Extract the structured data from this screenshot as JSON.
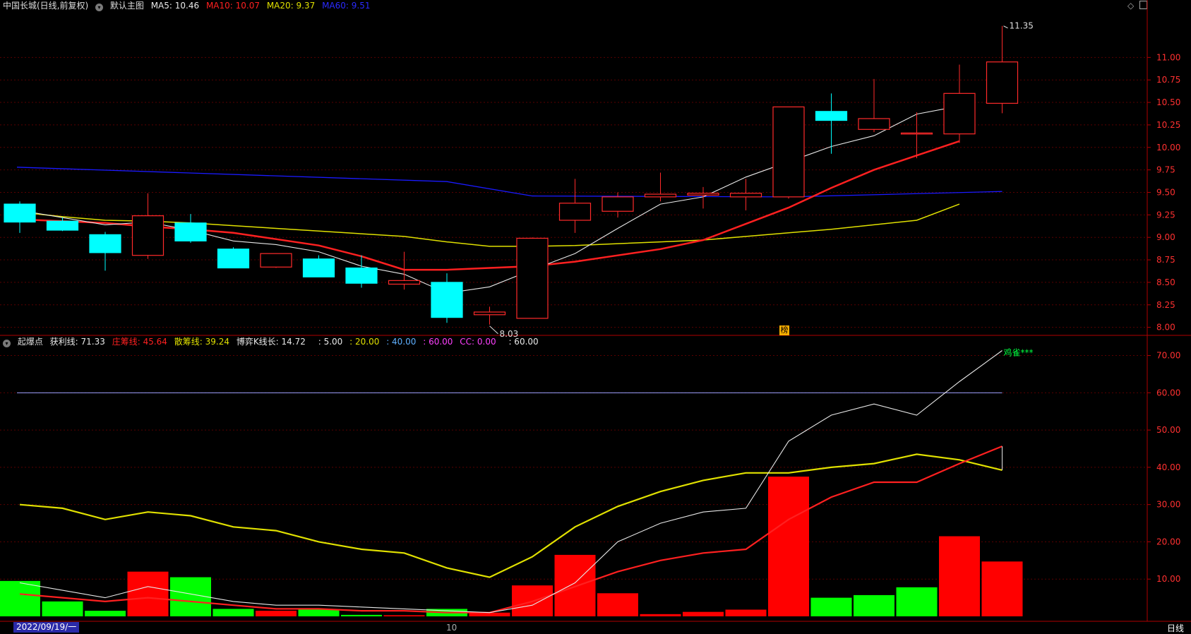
{
  "header_top": {
    "title": "中国长城(日线,前复权)",
    "main_chart": "默认主图",
    "ma5": "MA5: 10.46",
    "ma10": "MA10: 10.07",
    "ma20": "MA20: 9.37",
    "ma60": "MA60: 9.51"
  },
  "header_bottom": {
    "name": "起爆点",
    "profit": "获利线: 71.33",
    "dealer": "庄筹线: 45.64",
    "retail": "散筹线: 39.24",
    "game": "博弈K线长: 14.72",
    "v5": ": 5.00",
    "v20": ": 20.00",
    "v40": ": 40.00",
    "v60": ": 60.00",
    "cc": "CC: 0.00",
    "vw": ": 60.00"
  },
  "annotations": {
    "high_label": "11.35",
    "low_label": "8.03",
    "signal_label": "鸡雀***",
    "badge": "榜"
  },
  "footer": {
    "date": "2022/09/19/一",
    "month_label": "10",
    "period": "日线"
  },
  "colors": {
    "up": "#ff2a2a",
    "down": "#00ffff",
    "ma5": "#e8e8e8",
    "ma10": "#ff2020",
    "ma20": "#e0e000",
    "ma60": "#1a1aff",
    "bar_up": "#ff0000",
    "bar_down": "#00ff00",
    "grid": "#5a0000"
  },
  "chart_data": [
    {
      "type": "candlestick",
      "title": "中国长城(日线,前复权)",
      "ylim": [
        7.95,
        11.45
      ],
      "y_ticks": [
        8.0,
        8.25,
        8.5,
        8.75,
        9.0,
        9.25,
        9.5,
        9.75,
        10.0,
        10.25,
        10.5,
        10.75,
        11.0
      ],
      "candles": [
        {
          "o": 9.37,
          "h": 9.4,
          "l": 9.05,
          "c": 9.17
        },
        {
          "o": 9.18,
          "h": 9.22,
          "l": 9.07,
          "c": 9.08
        },
        {
          "o": 9.03,
          "h": 9.06,
          "l": 8.63,
          "c": 8.83
        },
        {
          "o": 8.8,
          "h": 9.49,
          "l": 8.76,
          "c": 9.24
        },
        {
          "o": 9.16,
          "h": 9.26,
          "l": 8.94,
          "c": 8.96
        },
        {
          "o": 8.87,
          "h": 8.89,
          "l": 8.66,
          "c": 8.66
        },
        {
          "o": 8.67,
          "h": 8.82,
          "l": 8.66,
          "c": 8.82
        },
        {
          "o": 8.76,
          "h": 8.8,
          "l": 8.56,
          "c": 8.56
        },
        {
          "o": 8.66,
          "h": 8.8,
          "l": 8.44,
          "c": 8.49
        },
        {
          "o": 8.48,
          "h": 8.84,
          "l": 8.42,
          "c": 8.52
        },
        {
          "o": 8.5,
          "h": 8.6,
          "l": 8.05,
          "c": 8.11
        },
        {
          "o": 8.14,
          "h": 8.23,
          "l": 8.03,
          "c": 8.17
        },
        {
          "o": 8.1,
          "h": 9.0,
          "l": 8.1,
          "c": 8.99
        },
        {
          "o": 9.19,
          "h": 9.65,
          "l": 9.05,
          "c": 9.38
        },
        {
          "o": 9.29,
          "h": 9.5,
          "l": 9.22,
          "c": 9.45
        },
        {
          "o": 9.45,
          "h": 9.72,
          "l": 9.4,
          "c": 9.48
        },
        {
          "o": 9.47,
          "h": 9.56,
          "l": 9.32,
          "c": 9.49
        },
        {
          "o": 9.45,
          "h": 9.65,
          "l": 9.3,
          "c": 9.49
        },
        {
          "o": 9.45,
          "h": 10.45,
          "l": 9.43,
          "c": 10.45
        },
        {
          "o": 10.4,
          "h": 10.6,
          "l": 9.93,
          "c": 10.3
        },
        {
          "o": 10.2,
          "h": 10.76,
          "l": 10.17,
          "c": 10.32
        },
        {
          "o": 10.15,
          "h": 10.39,
          "l": 9.88,
          "c": 10.16
        },
        {
          "o": 10.15,
          "h": 10.92,
          "l": 10.05,
          "c": 10.6
        },
        {
          "o": 10.49,
          "h": 11.35,
          "l": 10.38,
          "c": 10.95
        }
      ],
      "ma5": [
        9.3,
        9.22,
        9.14,
        9.17,
        9.08,
        8.96,
        8.92,
        8.84,
        8.68,
        8.59,
        8.38,
        8.45,
        8.64,
        8.82,
        9.1,
        9.37,
        9.45,
        9.67,
        9.84,
        10.01,
        10.13,
        10.37,
        10.46
      ],
      "ma10": [
        9.2,
        9.18,
        9.16,
        9.12,
        9.09,
        9.05,
        8.98,
        8.91,
        8.79,
        8.64,
        8.64,
        8.66,
        8.68,
        8.73,
        8.8,
        8.87,
        8.97,
        9.15,
        9.33,
        9.55,
        9.75,
        9.91,
        10.07
      ],
      "ma20": [
        9.28,
        9.23,
        9.19,
        9.18,
        9.16,
        9.13,
        9.1,
        9.07,
        9.04,
        9.01,
        8.95,
        8.9,
        8.9,
        8.91,
        8.93,
        8.95,
        8.97,
        9.01,
        9.05,
        9.09,
        9.14,
        9.19,
        9.37
      ],
      "ma60": [
        9.78,
        9.51
      ]
    },
    {
      "type": "bar_line",
      "title": "起爆点",
      "ylim": [
        0,
        72
      ],
      "y_ticks": [
        10,
        20,
        30,
        40,
        50,
        60,
        70
      ],
      "reference_line": 60,
      "bars": [
        {
          "v": 9.5,
          "up": false
        },
        {
          "v": 4.0,
          "up": false
        },
        {
          "v": 1.5,
          "up": false
        },
        {
          "v": 12.0,
          "up": true
        },
        {
          "v": 10.5,
          "up": false
        },
        {
          "v": 2.0,
          "up": false
        },
        {
          "v": 1.5,
          "up": true
        },
        {
          "v": 1.8,
          "up": false
        },
        {
          "v": 0.4,
          "up": false
        },
        {
          "v": 0.3,
          "up": true
        },
        {
          "v": 2.0,
          "up": false
        },
        {
          "v": 1.0,
          "up": true
        },
        {
          "v": 8.3,
          "up": true
        },
        {
          "v": 16.5,
          "up": true
        },
        {
          "v": 6.2,
          "up": true
        },
        {
          "v": 0.6,
          "up": true
        },
        {
          "v": 1.2,
          "up": true
        },
        {
          "v": 1.8,
          "up": true
        },
        {
          "v": 37.5,
          "up": true
        },
        {
          "v": 5.0,
          "up": false
        },
        {
          "v": 5.7,
          "up": false
        },
        {
          "v": 7.8,
          "up": false
        },
        {
          "v": 21.5,
          "up": true
        },
        {
          "v": 14.72,
          "up": true
        }
      ],
      "series": [
        {
          "name": "获利线",
          "values": [
            9,
            7,
            5,
            8,
            6,
            4,
            3,
            3,
            2.5,
            2,
            1.5,
            1,
            3,
            9,
            20,
            25,
            28,
            29,
            47,
            54,
            57,
            54,
            63,
            71.33
          ]
        },
        {
          "name": "庄筹线",
          "values": [
            6,
            5,
            4,
            5,
            4,
            3,
            2,
            2,
            1.5,
            1.5,
            1,
            1,
            4,
            8,
            12,
            15,
            17,
            18,
            26,
            32,
            36,
            36,
            41,
            45.64
          ]
        },
        {
          "name": "散筹线",
          "values": [
            30,
            29,
            26,
            28,
            27,
            24,
            23,
            20,
            18,
            17,
            13,
            10.5,
            16,
            24,
            29.5,
            33.5,
            36.5,
            38.5,
            38.5,
            40,
            41,
            43.5,
            42,
            39.24
          ]
        }
      ]
    }
  ]
}
